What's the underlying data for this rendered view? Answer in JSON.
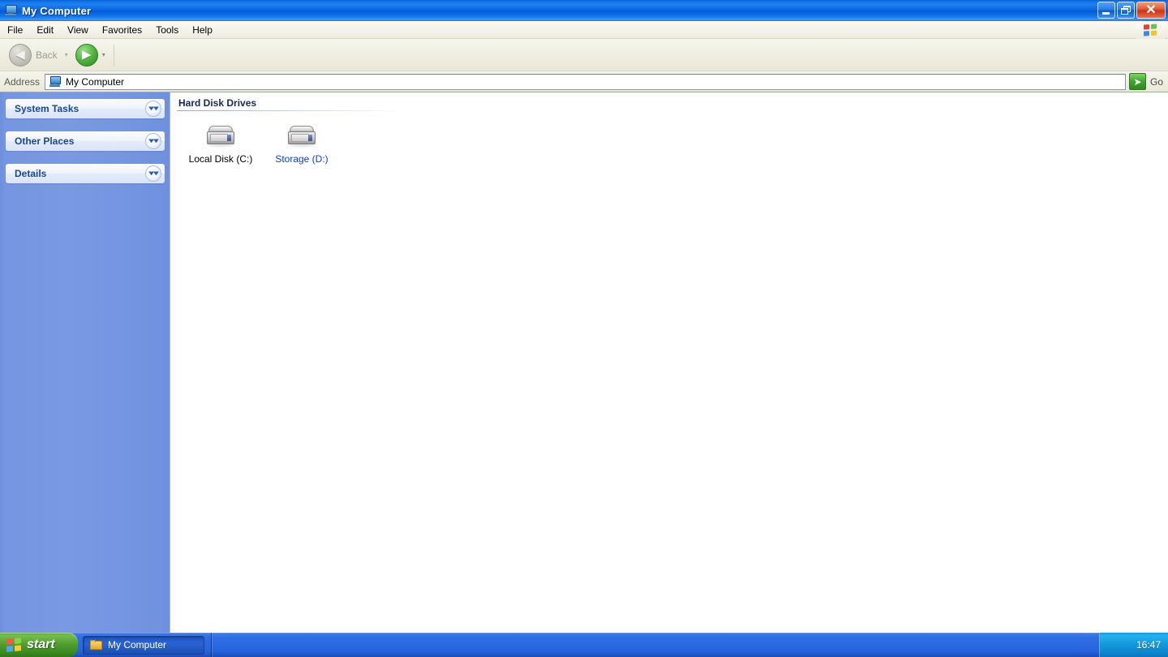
{
  "window": {
    "title": "My Computer",
    "icon": "my-computer-icon",
    "buttons": {
      "minimize": "minimize",
      "restore": "restore",
      "close": "✕"
    }
  },
  "menubar": {
    "items": [
      {
        "label": "File"
      },
      {
        "label": "Edit"
      },
      {
        "label": "View"
      },
      {
        "label": "Favorites"
      },
      {
        "label": "Tools"
      },
      {
        "label": "Help"
      }
    ],
    "brand_icon": "windows-flag-icon"
  },
  "toolbar": {
    "back_label": "Back",
    "back_icon": "back-arrow-icon",
    "back_caret": "▾",
    "forward_icon": "forward-arrow-icon",
    "forward_caret": "▾",
    "back_glyph": "◀",
    "forward_glyph": "▶"
  },
  "address": {
    "label": "Address",
    "value": "My Computer",
    "icon": "my-computer-icon",
    "go_label": "Go",
    "go_glyph": "➤",
    "go_icon": "go-arrow-icon"
  },
  "sidebar": {
    "panels": [
      {
        "title": "System Tasks",
        "chevron": "»",
        "state": "collapsed"
      },
      {
        "title": "Other Places",
        "chevron": "»",
        "state": "collapsed"
      },
      {
        "title": "Details",
        "chevron": "»",
        "state": "collapsed"
      }
    ]
  },
  "main": {
    "group_header": "Hard Disk Drives",
    "drives": [
      {
        "label": "Local Disk (C:)",
        "icon": "hard-disk-icon",
        "highlighted": false
      },
      {
        "label": "Storage (D:)",
        "icon": "hard-disk-icon",
        "highlighted": true
      }
    ]
  },
  "taskbar": {
    "start_label": "start",
    "start_icon": "windows-flag-icon",
    "tasks": [
      {
        "label": "My Computer",
        "icon": "folder-icon",
        "active": true
      }
    ],
    "clock": "16:47"
  },
  "colors": {
    "title_blue": "#0A64E0",
    "sidebar_blue": "#7A99E4",
    "panel_title": "#184796",
    "hot_label": "#0B3FD8",
    "start_green": "#4E9A2E",
    "taskbar_blue": "#2664DC",
    "tray_blue": "#169ADC",
    "go_green": "#3FA52E",
    "close_red": "#C8341A"
  }
}
